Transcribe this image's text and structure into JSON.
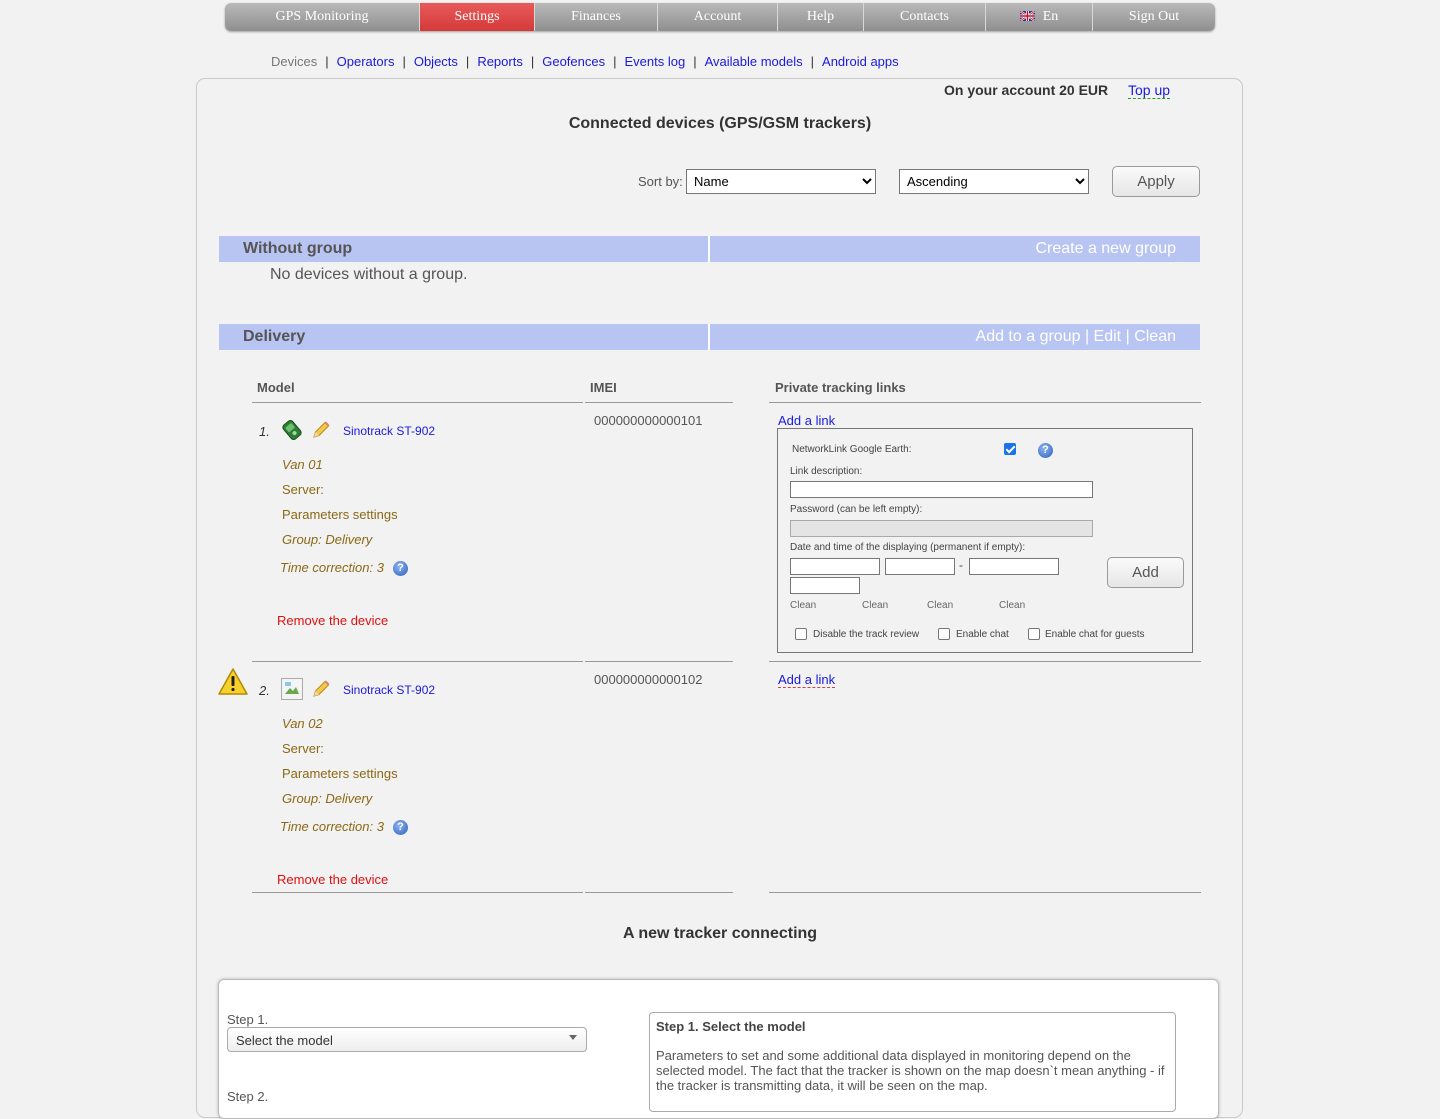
{
  "topnav": {
    "items": [
      {
        "label": "GPS Monitoring",
        "active": false
      },
      {
        "label": "Settings",
        "active": true
      },
      {
        "label": "Finances",
        "active": false
      },
      {
        "label": "Account",
        "active": false
      },
      {
        "label": "Help",
        "active": false
      },
      {
        "label": "Contacts",
        "active": false
      },
      {
        "label": "En",
        "active": false
      },
      {
        "label": "Sign Out",
        "active": false
      }
    ],
    "active_color": "#d9413f"
  },
  "subnav": {
    "items": [
      "Devices",
      "Operators",
      "Objects",
      "Reports",
      "Geofences",
      "Events log",
      "Available models",
      "Android apps"
    ],
    "separator": "|"
  },
  "account": {
    "balance_text": "On your account 20 EUR",
    "topup_label": "Top up"
  },
  "page_title": "Connected devices (GPS/GSM trackers)",
  "sort": {
    "label": "Sort by:",
    "field_value": "Name",
    "order_value": "Ascending",
    "apply_label": "Apply"
  },
  "groups": {
    "without_group": {
      "title": "Without group",
      "action": "Create a new group",
      "empty_text": "No devices without a group."
    },
    "delivery": {
      "title": "Delivery",
      "actions": [
        "Add to a group",
        "Edit",
        "Clean"
      ],
      "separator": "|"
    }
  },
  "table": {
    "headers": {
      "model": "Model",
      "imei": "IMEI",
      "links": "Private tracking links"
    }
  },
  "devices": [
    {
      "number": "1.",
      "model": "Sinotrack ST-902",
      "name": "Van 01",
      "server": "Server:",
      "params": "Parameters settings",
      "group": "Group: Delivery",
      "time_correction": "Time correction: 3",
      "remove": "Remove the device",
      "imei": "000000000000101",
      "add_link": "Add a link",
      "warning": false
    },
    {
      "number": "2.",
      "model": "Sinotrack ST-902",
      "name": "Van 02",
      "server": "Server:",
      "params": "Parameters settings",
      "group": "Group: Delivery",
      "time_correction": "Time correction: 3",
      "remove": "Remove the device",
      "imei": "000000000000102",
      "add_link": "Add a link",
      "warning": true
    }
  ],
  "link_form": {
    "networklink_label": "NetworkLink Google Earth:",
    "networklink_checked": true,
    "description_label": "Link description:",
    "password_label": "Password (can be left empty):",
    "datetime_label": "Date and time of the displaying (permanent if empty):",
    "range_separator": "-",
    "add_label": "Add",
    "clean_labels": [
      "Clean",
      "Clean",
      "Clean",
      "Clean"
    ],
    "checkboxes": [
      {
        "label": "Disable the track review",
        "checked": false
      },
      {
        "label": "Enable chat",
        "checked": false
      },
      {
        "label": "Enable chat for guests",
        "checked": false
      }
    ]
  },
  "new_tracker": {
    "title": "A new tracker connecting",
    "step1_label": "Step 1.",
    "step1_select": "Select the model",
    "step2_label": "Step 2.",
    "help_title": "Step 1. Select the model",
    "help_text": "Parameters to set and some additional data displayed in monitoring depend on the selected model. The fact that the tracker is shown on the map doesn`t mean anything - if the tracker is transmitting data, it will be seen on the map."
  }
}
